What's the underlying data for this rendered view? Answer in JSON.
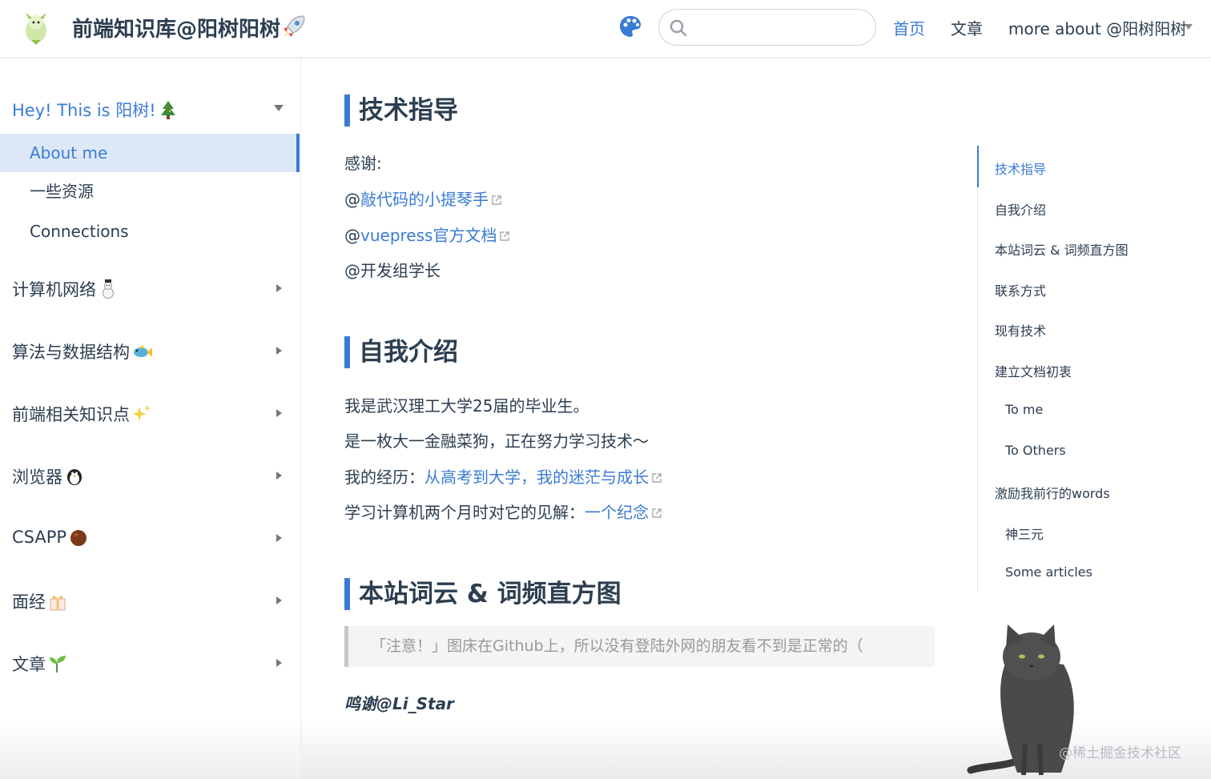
{
  "navbar": {
    "title": "前端知识库@阳树阳树",
    "search": {
      "value": "",
      "placeholder": ""
    },
    "links": {
      "home": "首页",
      "articles": "文章",
      "more": "more about @阳树阳树"
    }
  },
  "sidebar": {
    "top_group": {
      "label": "Hey! This is 阳树!",
      "emoji": "tree-icon"
    },
    "items": [
      {
        "label": "About me",
        "active": true
      },
      {
        "label": "一些资源"
      },
      {
        "label": "Connections"
      }
    ],
    "groups": [
      {
        "label": "计算机网络",
        "emoji": "snowman-icon"
      },
      {
        "label": "算法与数据结构",
        "emoji": "fish-icon"
      },
      {
        "label": "前端相关知识点",
        "emoji": "sparkles-icon"
      },
      {
        "label": "浏览器",
        "emoji": "penguin-icon"
      },
      {
        "label": "CSAPP",
        "emoji": "chestnut-icon"
      },
      {
        "label": "面经",
        "emoji": "gift-icon"
      },
      {
        "label": "文章",
        "emoji": "seedling-icon"
      }
    ]
  },
  "content": {
    "section1": {
      "title": "技术指导",
      "thanks": "感谢:",
      "link1_prefix": "@",
      "link1": "敲代码的小提琴手",
      "link2_prefix": "@",
      "link2": "vuepress官方文档",
      "line3": "@开发组学长"
    },
    "section2": {
      "title": "自我介绍",
      "line1": "我是武汉理工大学25届的毕业生。",
      "line2": "是一枚大一金融菜狗，正在努力学习技术～",
      "line3_prefix": "我的经历：",
      "line3_link": "从高考到大学，我的迷茫与成长",
      "line4_prefix": "学习计算机两个月时对它的见解：",
      "line4_link": "一个纪念"
    },
    "section3": {
      "title": "本站词云 & 词频直方图",
      "quote": "「注意！」图床在Github上，所以没有登陆外网的朋友看不到是正常的（",
      "credit": "鸣谢@Li_Star"
    }
  },
  "toc": [
    {
      "label": "技术指导",
      "active": true
    },
    {
      "label": "自我介绍"
    },
    {
      "label": "本站词云 & 词频直方图"
    },
    {
      "label": "联系方式"
    },
    {
      "label": "现有技术"
    },
    {
      "label": "建立文档初衷"
    },
    {
      "label": "To me",
      "sub": true
    },
    {
      "label": "To Others",
      "sub": true
    },
    {
      "label": "激励我前行的words"
    },
    {
      "label": "神三元",
      "sub": true
    },
    {
      "label": "Some articles",
      "sub": true
    }
  ],
  "watermark": "@稀土掘金技术社区",
  "colors": {
    "accent": "#3a7bd5",
    "text": "#2c3e50",
    "active_bg": "#dde8f6"
  }
}
